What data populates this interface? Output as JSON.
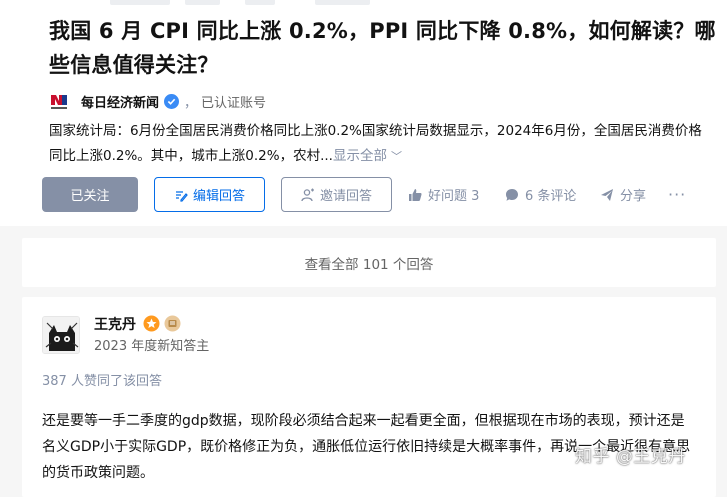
{
  "question": {
    "title": "我国 6 月 CPI 同比上涨 0.2%，PPI 同比下降 0.8%，如何解读？哪些信息值得关注？",
    "source": {
      "name": "每日经济新闻",
      "separator": "，",
      "verified_label": "已认证账号",
      "logo_icon": "nbd-logo",
      "verified_icon": "verified-badge-icon"
    },
    "excerpt": "国家统计局：6月份全国居民消费价格同比上涨0.2%国家统计局数据显示，2024年6月份，全国居民消费价格同比上涨0.2%。其中，城市上涨0.2%，农村...",
    "show_all_label": "显示全部"
  },
  "actions": {
    "followed_label": "已关注",
    "edit_answer_label": "编辑回答",
    "invite_answer_label": "邀请回答",
    "good_question_label": "好问题 3",
    "comments_label": "6 条评论",
    "share_label": "分享",
    "more_label": "···"
  },
  "view_all_answers_label": "查看全部 101 个回答",
  "answer": {
    "author_name": "王克丹",
    "author_bio": "2023 年度新知答主",
    "vote_summary": "387 人赞同了该回答",
    "body": "还是要等一手二季度的gdp数据，现阶段必须结合起来一起看更全面，但根据现在市场的表现，预计还是名义GDP小于实际GDP，既价格修正为负，通胀低位运行依旧持续是大概率事件，再说一个最近很有意思的货币政策问题。"
  },
  "watermark": "知乎 @王克丹",
  "colors": {
    "brand_blue": "#056de8",
    "muted_gray": "#8590a6",
    "page_bg": "#f6f6f6"
  }
}
